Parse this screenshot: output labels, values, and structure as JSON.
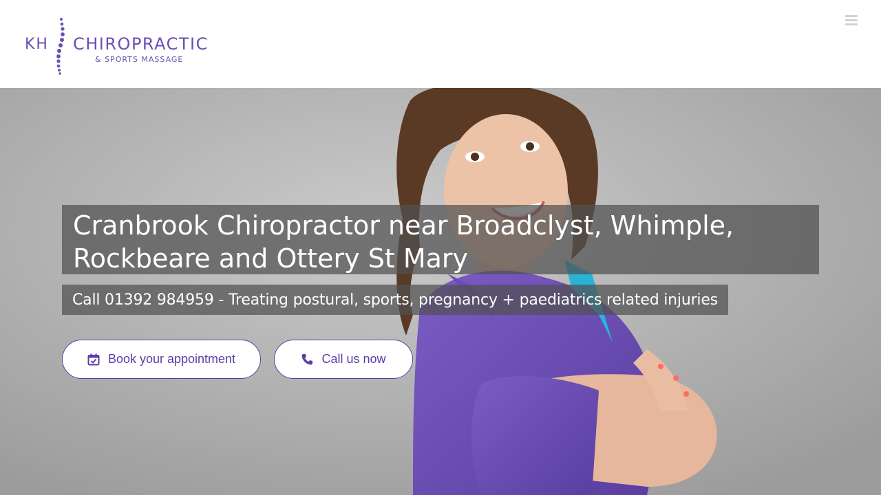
{
  "logo": {
    "initials": "KH",
    "name": "CHIROPRACTIC",
    "tagline": "& SPORTS MASSAGE"
  },
  "header": {
    "menu_icon": "hamburger-menu-icon"
  },
  "hero": {
    "headline": "Cranbrook Chiropractor near Broadclyst, Whimple, Rockbeare and Ottery St Mary",
    "subline": "Call 01392 984959 - Treating postural, sports, pregnancy + paediatrics related injuries",
    "book_button": {
      "label": "Book your appointment",
      "icon": "calendar-check-icon"
    },
    "call_button": {
      "label": "Call us now",
      "icon": "phone-icon"
    }
  },
  "colors": {
    "brand_purple": "#5b3da8",
    "overlay": "#505050"
  }
}
